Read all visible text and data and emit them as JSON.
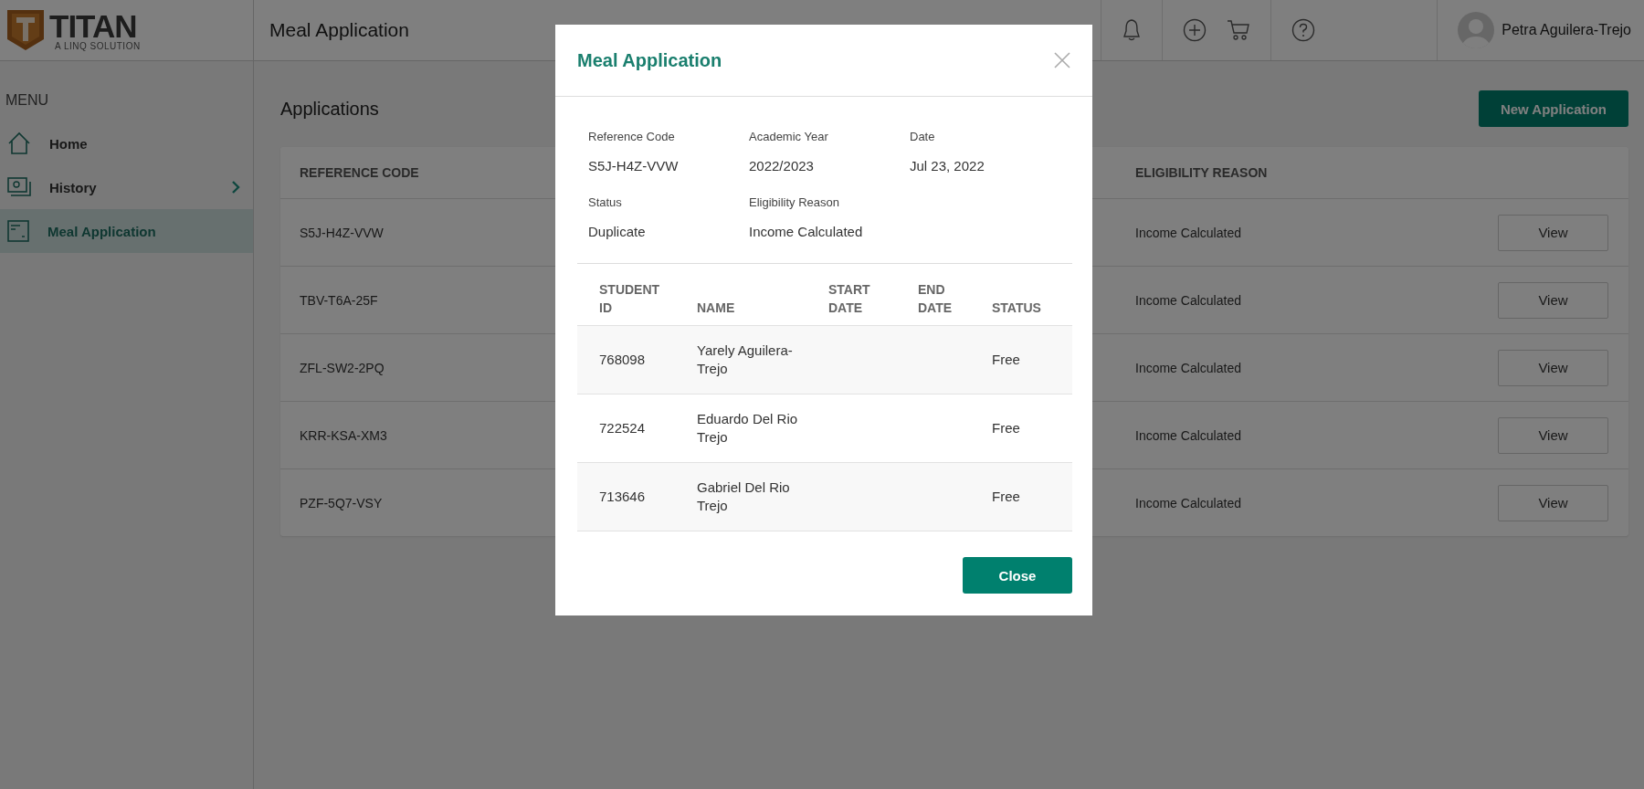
{
  "header": {
    "logo": {
      "name": "TITAN",
      "tagline": "A LINQ SOLUTION"
    },
    "title": "Meal Application",
    "user_name": "Petra Aguilera-Trejo"
  },
  "sidebar": {
    "heading": "MENU",
    "items": [
      {
        "label": "Home",
        "selected": false,
        "submenu": false
      },
      {
        "label": "History",
        "selected": false,
        "submenu": true
      },
      {
        "label": "Meal Application",
        "selected": true,
        "submenu": false
      }
    ]
  },
  "main": {
    "title": "Applications",
    "new_button": "New Application",
    "table": {
      "columns": [
        "REFERENCE CODE",
        "ELIGIBILITY REASON"
      ],
      "rows": [
        {
          "reference_code": "S5J-H4Z-VVW",
          "eligibility_reason": "Income Calculated",
          "action": "View"
        },
        {
          "reference_code": "TBV-T6A-25F",
          "eligibility_reason": "Income Calculated",
          "action": "View"
        },
        {
          "reference_code": "ZFL-SW2-2PQ",
          "eligibility_reason": "Income Calculated",
          "action": "View"
        },
        {
          "reference_code": "KRR-KSA-XM3",
          "eligibility_reason": "Income Calculated",
          "action": "View"
        },
        {
          "reference_code": "PZF-5Q7-VSY",
          "eligibility_reason": "Income Calculated",
          "action": "View"
        }
      ]
    }
  },
  "modal": {
    "title": "Meal Application",
    "fields": [
      {
        "label": "Reference Code",
        "value": "S5J-H4Z-VVW"
      },
      {
        "label": "Academic Year",
        "value": "2022/2023"
      },
      {
        "label": "Date",
        "value": "Jul 23, 2022"
      },
      {
        "label": "Status",
        "value": "Duplicate"
      },
      {
        "label": "Eligibility Reason",
        "value": "Income Calculated"
      }
    ],
    "table": {
      "columns": [
        "STUDENT ID",
        "NAME",
        "START DATE",
        "END DATE",
        "STATUS"
      ],
      "rows": [
        {
          "student_id": "768098",
          "name": "Yarely Aguilera-Trejo",
          "status": "Free"
        },
        {
          "student_id": "722524",
          "name": "Eduardo Del Rio Trejo",
          "status": "Free"
        },
        {
          "student_id": "713646",
          "name": "Gabriel Del Rio Trejo",
          "status": "Free"
        }
      ]
    },
    "close_button": "Close"
  }
}
